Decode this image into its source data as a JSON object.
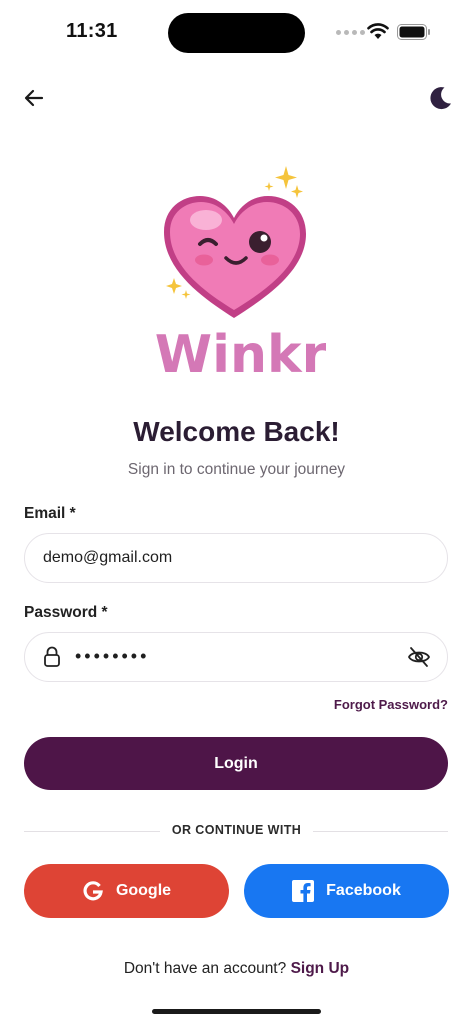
{
  "status_bar": {
    "time": "11:31"
  },
  "nav": {
    "back_icon": "arrow-left-icon",
    "theme_icon": "moon-icon"
  },
  "brand": {
    "name": "Winkr"
  },
  "header": {
    "title": "Welcome Back!",
    "subtitle": "Sign in to continue your journey"
  },
  "form": {
    "email_label": "Email *",
    "email_value": "demo@gmail.com",
    "password_label": "Password *",
    "password_value": "••••••••",
    "forgot_label": "Forgot Password?",
    "login_label": "Login"
  },
  "divider": {
    "text": "OR CONTINUE WITH"
  },
  "social": {
    "google_label": "Google",
    "facebook_label": "Facebook"
  },
  "footer": {
    "prompt": "Don't have an account?",
    "signup_label": "Sign Up"
  },
  "colors": {
    "primary": "#4e1548",
    "google": "#de4435",
    "facebook": "#1877f2",
    "logo_pink": "#d76fb6"
  }
}
